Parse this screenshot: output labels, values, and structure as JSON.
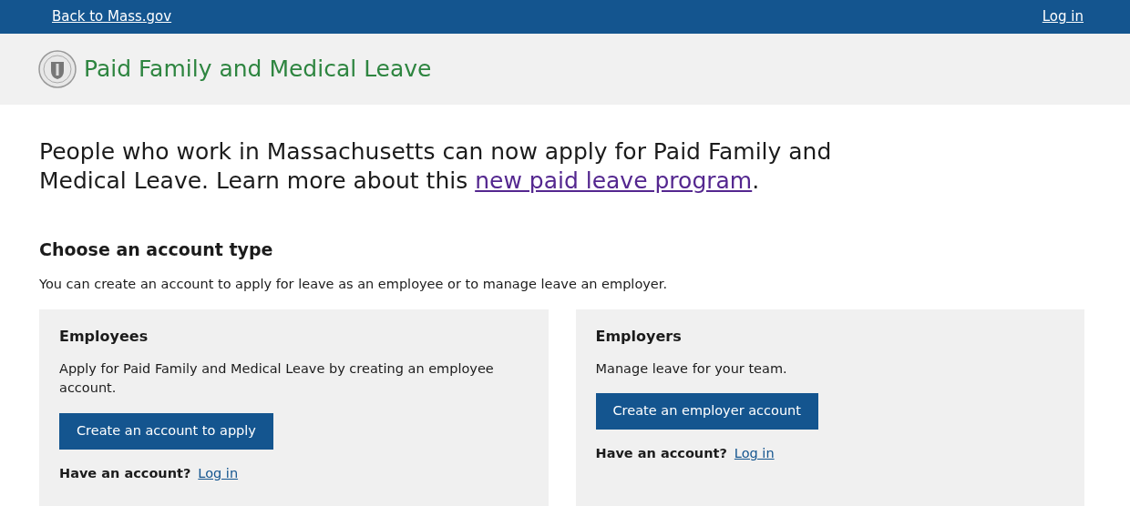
{
  "top_bar": {
    "back_link": "Back to Mass.gov",
    "login_link": "Log in"
  },
  "header": {
    "title": "Paid Family and Medical Leave"
  },
  "intro": "People who work in Massachusetts can now apply for Paid Family and Medical Leave. Learn more about this ",
  "intro_link": "new paid leave program",
  "intro_end": ".",
  "section": {
    "heading": "Choose an account type",
    "description": "You can create an account to apply for leave as an employee or to manage leave an employer."
  },
  "cards": [
    {
      "title": "Employees",
      "text": "Apply for Paid Family and Medical Leave by creating an employee account.",
      "button": "Create an account to apply",
      "prompt": "Have an account?",
      "link": "Log in"
    },
    {
      "title": "Employers",
      "text": "Manage leave for your team.",
      "button": "Create an employer account",
      "prompt": "Have an account?",
      "link": "Log in"
    }
  ]
}
